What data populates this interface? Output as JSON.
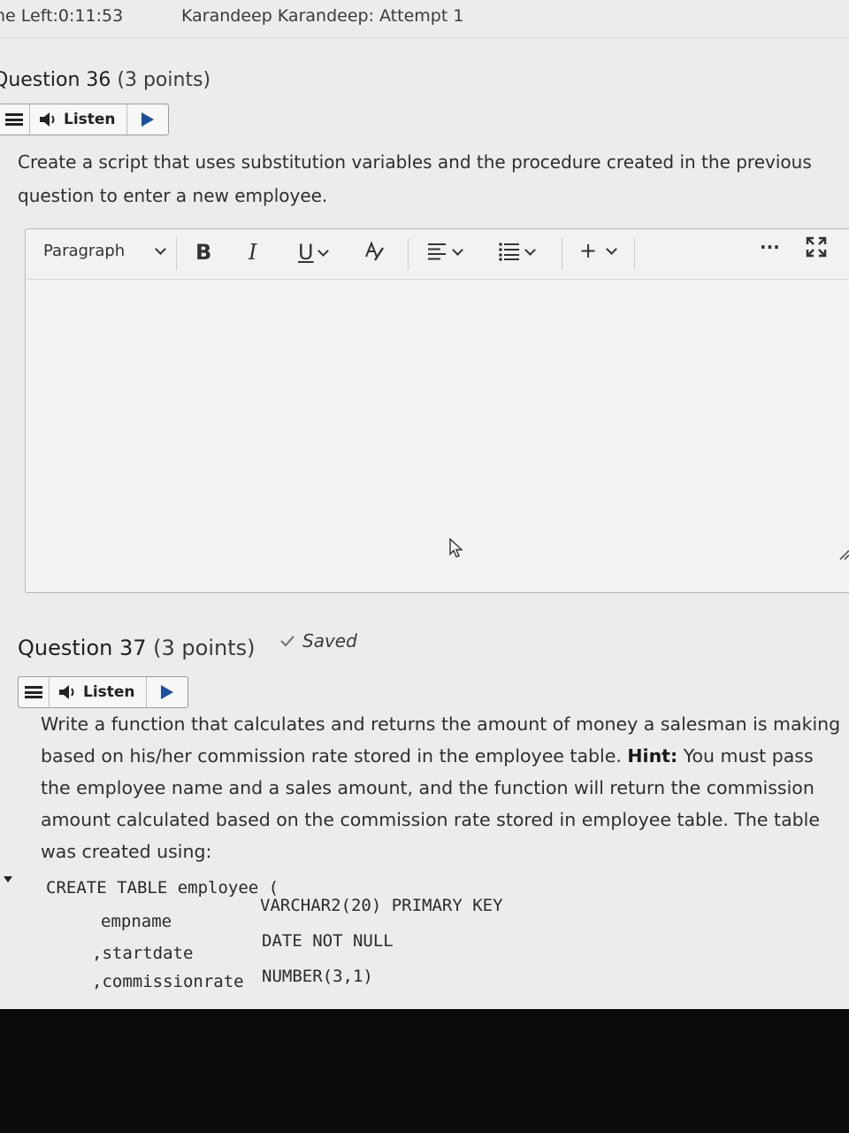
{
  "header": {
    "time_left": "ne Left:0:11:53",
    "attempt": "Karandeep Karandeep: Attempt 1"
  },
  "question36": {
    "title": "Question 36",
    "points": "(3 points)",
    "listen_label": "Listen",
    "prompt": "Create a script that uses substitution variables and the procedure created in the previous question to enter a new employee."
  },
  "editor": {
    "block_format": "Paragraph",
    "bold": "B",
    "italic": "I",
    "underline": "U",
    "add": "+",
    "more": "···"
  },
  "question37": {
    "title": "Question 37",
    "points": "(3 points)",
    "saved": "Saved",
    "listen_label": "Listen",
    "prompt_part1": "Write a function that calculates and returns the amount of money a salesman is making based on his/her commission rate stored in the employee table. ",
    "hint_label": "Hint:",
    "prompt_part2": " You must pass the employee name and a sales amount, and the function will return the commission amount calculated based on the commission rate stored in employee table. The table was created using:",
    "code": {
      "line1": "CREATE TABLE employee (",
      "col1_name": "empname",
      "col1_type": "VARCHAR2(20) PRIMARY KEY",
      "col2_name": ",startdate",
      "col2_type": "DATE NOT NULL",
      "col3_name": ",commissionrate",
      "col3_type": "NUMBER(3,1)"
    }
  },
  "colors": {
    "play_button": "#1b4fa0",
    "screen_bg": "#ececea"
  }
}
